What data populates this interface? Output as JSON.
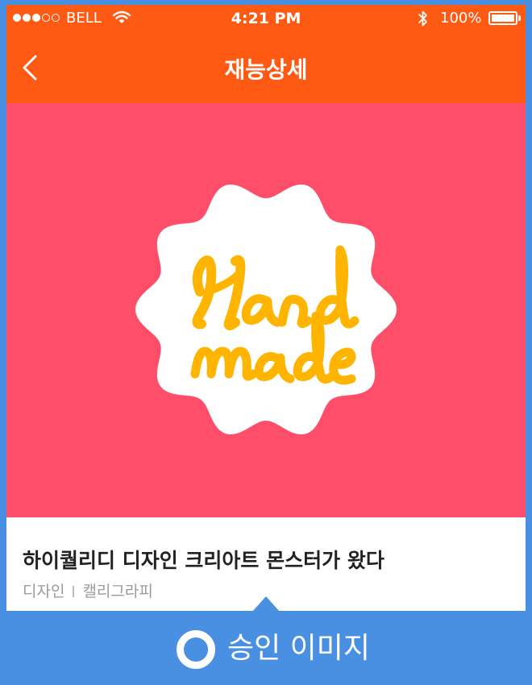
{
  "status_bar": {
    "carrier": "BELL",
    "time": "4:21 PM",
    "battery_percent": "100%",
    "signal_bars_filled": 3,
    "signal_bars_total": 5,
    "battery_level": 1.0,
    "icons": [
      "signal-dots-icon",
      "wifi-icon",
      "bluetooth-icon",
      "battery-icon"
    ]
  },
  "nav": {
    "title": "재능상세",
    "back_icon": "chevron-left-icon"
  },
  "hero": {
    "background_color": "#FF4E6A",
    "badge_color": "#FFFFFF",
    "lettering_color": "#FFB400",
    "lettering": "Hand made"
  },
  "item": {
    "title": "하이퀄리디 디자인 크리아트 몬스터가 왔다",
    "category": "디자인",
    "subcategory": "캘리그라피"
  },
  "caption": {
    "text": "승인 이미지",
    "icon": "circle-icon"
  },
  "colors": {
    "accent": "#FF5A14",
    "frame": "#4A90E2",
    "hero": "#FF4E6A"
  }
}
